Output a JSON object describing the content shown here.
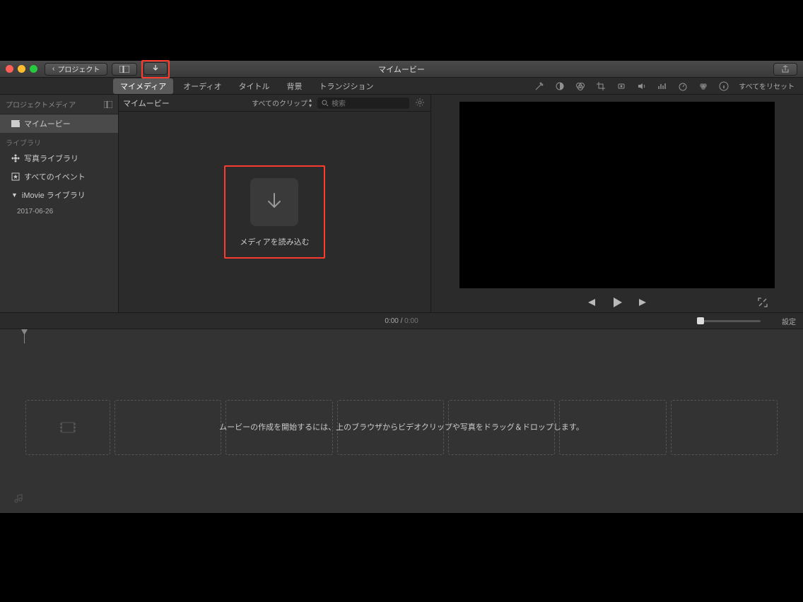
{
  "toolbar": {
    "projects_label": "プロジェクト",
    "window_title": "マイムービー"
  },
  "tabs": {
    "items": [
      "マイメディア",
      "オーディオ",
      "タイトル",
      "背景",
      "トランジション"
    ],
    "reset_label": "すべてをリセット"
  },
  "sidebar": {
    "header": "プロジェクトメディア",
    "project_item": "マイムービー",
    "library_section": "ライブラリ",
    "photo_library": "写真ライブラリ",
    "all_events": "すべてのイベント",
    "imovie_library": "iMovie ライブラリ",
    "event_date": "2017-06-26"
  },
  "browser": {
    "title": "マイムービー",
    "clip_filter": "すべてのクリップ",
    "search_placeholder": "検索",
    "import_label": "メディアを読み込む"
  },
  "timeline": {
    "current_time": "0:00",
    "total_time": "0:00",
    "settings_label": "設定",
    "hint": "ムービーの作成を開始するには、上のブラウザからビデオクリップや写真をドラッグ＆ドロップします。"
  }
}
